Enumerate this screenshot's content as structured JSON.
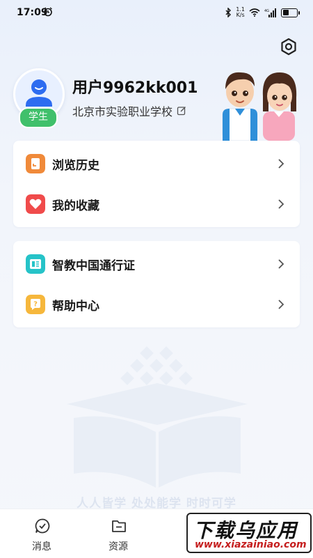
{
  "status_bar": {
    "time": "17:09",
    "net_speed_value": "1.1",
    "net_speed_unit": "K/s",
    "network": "4G",
    "battery_level": 0.45
  },
  "profile": {
    "username": "用户9962kk001",
    "role_badge": "学生",
    "school": "北京市实验职业学校"
  },
  "menu_groups": [
    [
      {
        "label": "浏览历史",
        "icon": "history-icon",
        "color": "#f08a3a"
      },
      {
        "label": "我的收藏",
        "icon": "heart-icon",
        "color": "#f04b4b"
      }
    ],
    [
      {
        "label": "智教中国通行证",
        "icon": "pass-card-icon",
        "color": "#26c3c8"
      },
      {
        "label": "帮助中心",
        "icon": "help-icon",
        "color": "#f6b73c"
      }
    ]
  ],
  "slogan": "人人皆学 处处能学 时时可学",
  "bottom_nav": [
    {
      "label": "消息",
      "icon": "message-icon"
    },
    {
      "label": "资源",
      "icon": "folder-icon"
    }
  ],
  "watermark": {
    "title": "下载乌应用",
    "url": "www.xiazainiao.com"
  },
  "colors": {
    "accent_blue": "#2d6cf0",
    "badge_green": "#40c06b"
  }
}
